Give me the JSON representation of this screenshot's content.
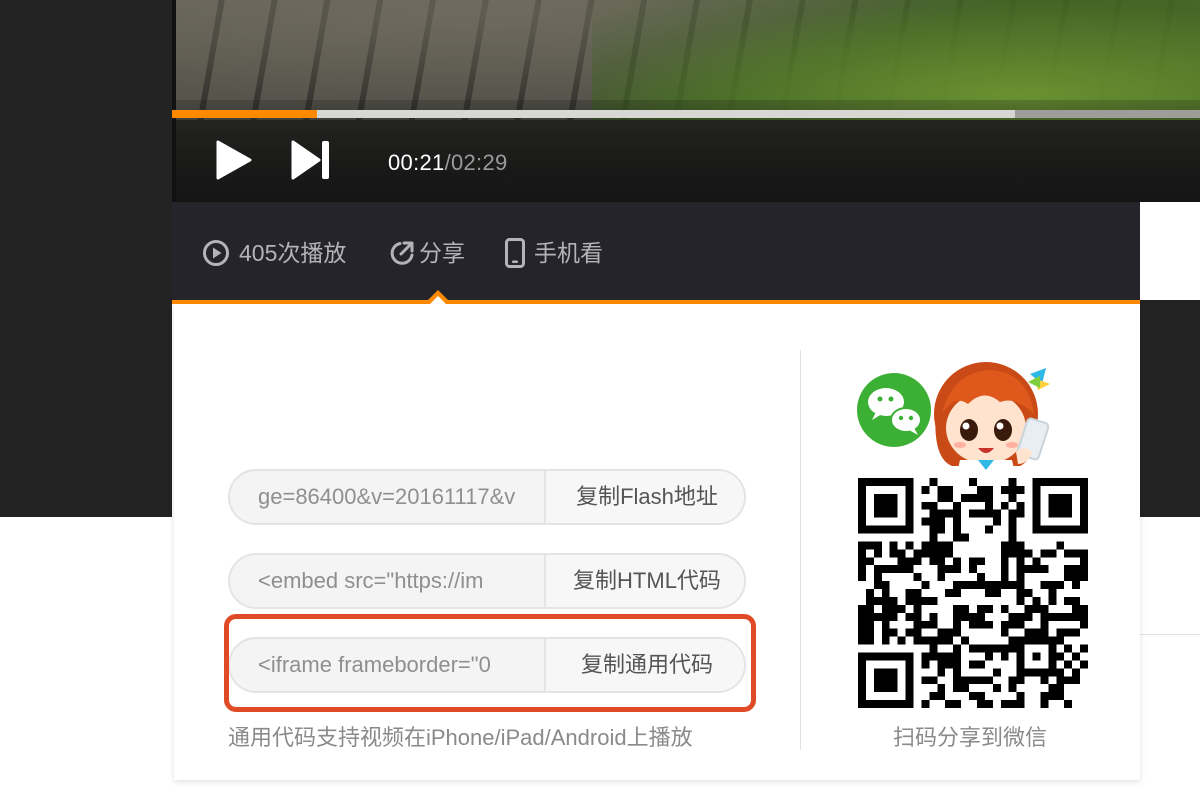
{
  "player": {
    "time_current": "00:21",
    "time_separator": "/",
    "time_total": "02:29",
    "progress_fraction": 0.141,
    "buffered_fraction": 0.82,
    "accent_color": "#ff8a00"
  },
  "info_bar": {
    "plays_label": "405次播放",
    "share_label": "分享",
    "mobile_label": "手机看",
    "icons": [
      "play-circle-icon",
      "share-icon",
      "phone-icon"
    ]
  },
  "share_panel": {
    "flash_value": "ge=86400&v=20161117&v",
    "flash_button": "复制Flash地址",
    "html_value": "<embed src=\"https://im",
    "html_button": "复制HTML代码",
    "iframe_value": "<iframe frameborder=\"0",
    "iframe_button": "复制通用代码",
    "note": "通用代码支持视频在iPhone/iPad/Android上播放",
    "highlight_color": "#df4b26"
  },
  "wechat": {
    "caption": "扫码分享到微信",
    "icons": [
      "wechat-icon",
      "mascot-illustration",
      "qr-code"
    ]
  }
}
